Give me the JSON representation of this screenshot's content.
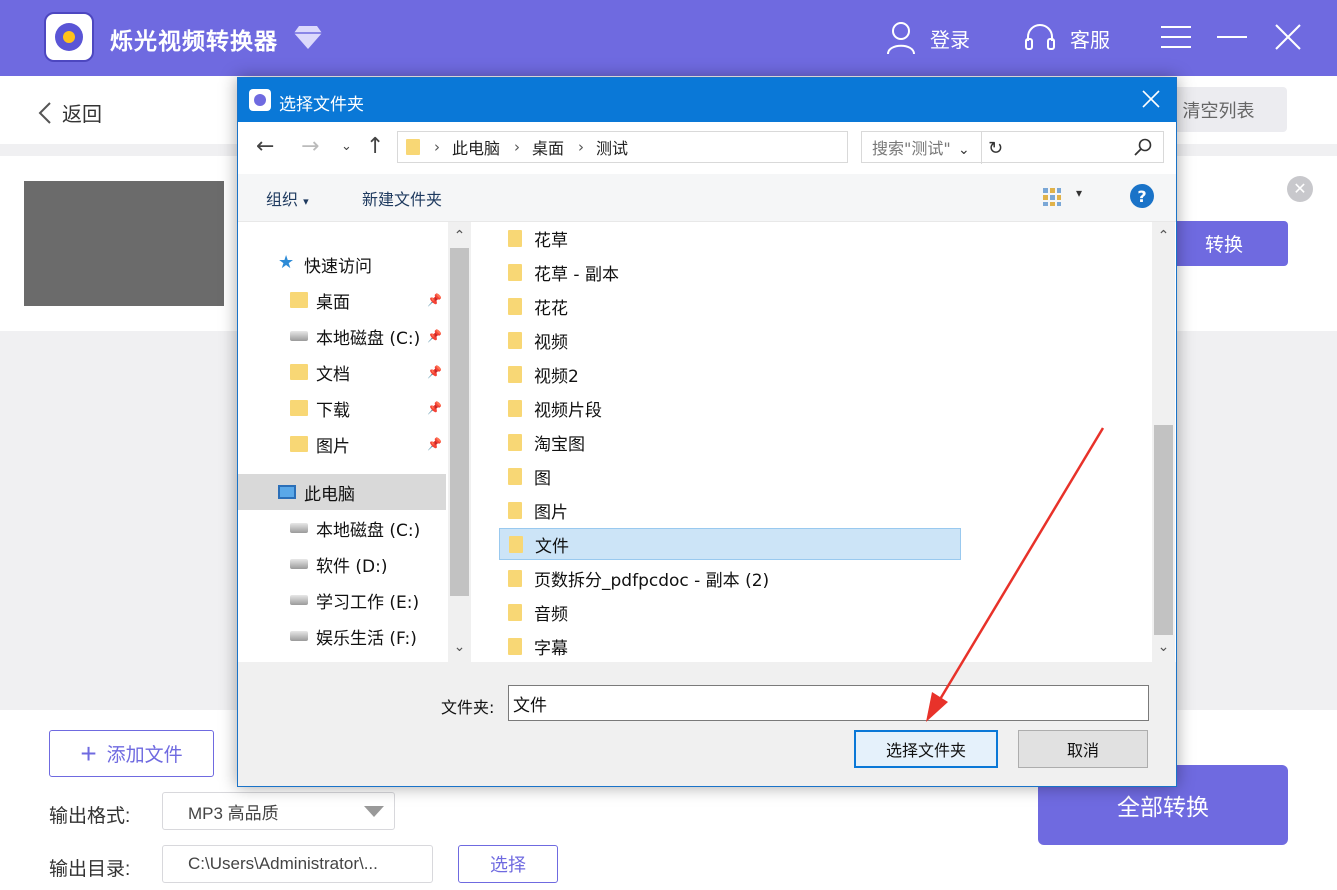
{
  "app": {
    "title": "烁光视频转换器",
    "login_label": "登录",
    "service_label": "客服",
    "back_label": "返回",
    "clear_list_label": "清空列表",
    "convert_label": "转换",
    "add_file_label": "添加文件",
    "output_format_label": "输出格式:",
    "output_format_value": "MP3 高品质",
    "output_dir_label": "输出目录:",
    "output_dir_value": "C:\\Users\\Administrator\\...",
    "choose_label": "选择",
    "convert_all_label": "全部转换",
    "accent_color": "#6f6ae0"
  },
  "dialog": {
    "title": "选择文件夹",
    "breadcrumb": [
      "此电脑",
      "桌面",
      "测试"
    ],
    "search_placeholder": "搜索\"测试\"",
    "organize_label": "组织",
    "new_folder_label": "新建文件夹",
    "nav": {
      "quick_access": "快速访问",
      "quick_items": [
        "桌面",
        "本地磁盘 (C:)",
        "文档",
        "下载",
        "图片"
      ],
      "this_pc": "此电脑",
      "drives": [
        "本地磁盘 (C:)",
        "软件 (D:)",
        "学习工作 (E:)",
        "娱乐生活 (F:)"
      ]
    },
    "folders": [
      "花草",
      "花草 - 副本",
      "花花",
      "视频",
      "视频2",
      "视频片段",
      "淘宝图",
      "图",
      "图片",
      "文件",
      "页数拆分_pdfpcdoc - 副本 (2)",
      "音频",
      "字幕"
    ],
    "selected_folder": "文件",
    "folder_label": "文件夹:",
    "folder_value": "文件",
    "select_button": "选择文件夹",
    "cancel_button": "取消",
    "titlebar_color": "#0a78d7"
  }
}
